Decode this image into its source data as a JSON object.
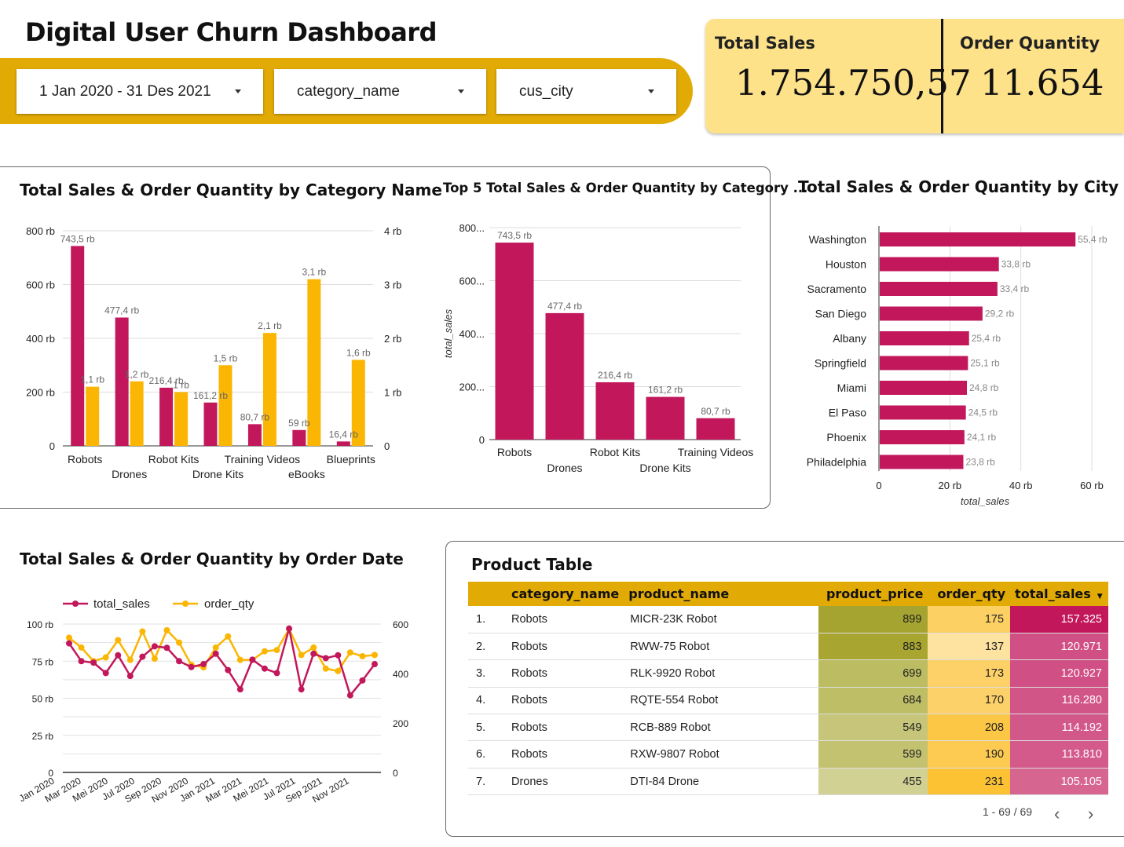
{
  "page": {
    "title": "Digital User Churn Dashboard"
  },
  "filters": [
    {
      "label": "1 Jan 2020 - 31 Des 2021",
      "icon": "chevron-down-icon"
    },
    {
      "label": "category_name",
      "icon": "chevron-down-icon"
    },
    {
      "label": "cus_city",
      "icon": "chevron-down-icon"
    }
  ],
  "kpis": [
    {
      "label": "Total Sales",
      "value": "1.754.750,57"
    },
    {
      "label": "Order Quantity",
      "value": "11.654"
    }
  ],
  "colors": {
    "sales": "#c2185b",
    "qty": "#fbb603",
    "accent": "#e2aa05",
    "kpi_bg": "#fde28a"
  },
  "chart_data": [
    {
      "type": "bar",
      "title": "Total Sales & Order Quantity by Category Name",
      "categories": [
        "Robots",
        "Drones",
        "Robot Kits",
        "Drone Kits",
        "Training Videos",
        "eBooks",
        "Blueprints"
      ],
      "series": [
        {
          "name": "total_sales",
          "axis": "left",
          "values": [
            743.5,
            477.4,
            216.4,
            161.2,
            80.7,
            59,
            16.4
          ],
          "labels": [
            "743,5 rb",
            "477,4 rb",
            "216,4 rb",
            "161,2 rb",
            "80,7 rb",
            "59 rb",
            "16,4 rb"
          ]
        },
        {
          "name": "order_qty",
          "axis": "right",
          "values": [
            1.1,
            1.2,
            1,
            1.5,
            2.1,
            3.1,
            1.6
          ],
          "labels": [
            "1,1 rb",
            "1,2 rb",
            "1 rb",
            "1,5 rb",
            "2,1 rb",
            "3,1 rb",
            "1,6 rb"
          ]
        }
      ],
      "y_left_ticks": [
        "0",
        "200 rb",
        "400 rb",
        "600 rb",
        "800 rb"
      ],
      "y_right_ticks": [
        "0",
        "1 rb",
        "2 rb",
        "3 rb",
        "4 rb"
      ],
      "ylim_left": [
        0,
        800
      ],
      "ylim_right": [
        0,
        4
      ],
      "grid": true
    },
    {
      "type": "bar",
      "title": "Top 5 Total Sales & Order Quantity by Category ...",
      "categories": [
        "Robots",
        "Drones",
        "Robot Kits",
        "Drone Kits",
        "Training Videos"
      ],
      "series": [
        {
          "name": "total_sales",
          "values": [
            743.5,
            477.4,
            216.4,
            161.2,
            80.7
          ],
          "labels": [
            "743,5 rb",
            "477,4 rb",
            "216,4 rb",
            "161,2 rb",
            "80,7 rb"
          ]
        }
      ],
      "ylabel": "total_sales",
      "y_ticks": [
        "0",
        "200...",
        "400...",
        "600...",
        "800..."
      ],
      "ylim": [
        0,
        800
      ],
      "grid": true
    },
    {
      "type": "bar",
      "orientation": "horizontal",
      "title": "Total Sales & Order Quantity by City",
      "categories": [
        "Washington",
        "Houston",
        "Sacramento",
        "San Diego",
        "Albany",
        "Springfield",
        "Miami",
        "El Paso",
        "Phoenix",
        "Philadelphia"
      ],
      "series": [
        {
          "name": "total_sales",
          "values": [
            55.4,
            33.8,
            33.4,
            29.2,
            25.4,
            25.1,
            24.8,
            24.5,
            24.1,
            23.8
          ],
          "labels": [
            "55,4 rb",
            "33,8 rb",
            "33,4 rb",
            "29,2 rb",
            "25,4 rb",
            "25,1 rb",
            "24,8 rb",
            "24,5 rb",
            "24,1 rb",
            "23,8 rb"
          ]
        }
      ],
      "xlabel": "total_sales",
      "x_ticks": [
        "0",
        "20 rb",
        "40 rb",
        "60 rb"
      ],
      "xlim": [
        0,
        60
      ],
      "grid": true
    },
    {
      "type": "line",
      "title": "Total Sales & Order Quantity by Order Date",
      "legend": [
        "total_sales",
        "order_qty"
      ],
      "legend_position": "top-left",
      "x_ticks": [
        "Jan 2020",
        "Mar 2020",
        "Mei 2020",
        "Jul 2020",
        "Sep 2020",
        "Nov 2020",
        "Jan 2021",
        "Mar 2021",
        "Mei 2021",
        "Jul 2021",
        "Sep 2021",
        "Nov 2021"
      ],
      "y_left_ticks": [
        "0",
        "25 rb",
        "50 rb",
        "75 rb",
        "100 rb"
      ],
      "y_right_ticks": [
        "0",
        "200",
        "400",
        "600"
      ],
      "ylim_left": [
        0,
        100
      ],
      "ylim_right": [
        0,
        600
      ],
      "series": [
        {
          "name": "total_sales",
          "axis": "left",
          "values": [
            87,
            75,
            74,
            67,
            79,
            65,
            78,
            85,
            84,
            75,
            71,
            73,
            80,
            69,
            56,
            76,
            70,
            67,
            97,
            56,
            80,
            77,
            79,
            52,
            62,
            73
          ]
        },
        {
          "name": "order_qty",
          "axis": "right",
          "values": [
            545,
            505,
            450,
            465,
            535,
            455,
            570,
            460,
            575,
            525,
            435,
            425,
            505,
            550,
            455,
            455,
            490,
            495,
            580,
            475,
            505,
            420,
            410,
            485,
            470,
            475
          ]
        }
      ],
      "grid": true
    }
  ],
  "product_table": {
    "title": "Product Table",
    "columns": [
      "category_name",
      "product_name",
      "product_price",
      "order_qty",
      "total_sales"
    ],
    "sort_icon": "sort-down-icon",
    "rows": [
      [
        "1.",
        "Robots",
        "MICR-23K Robot",
        "899",
        "175",
        "157.325"
      ],
      [
        "2.",
        "Robots",
        "RWW-75 Robot",
        "883",
        "137",
        "120.971"
      ],
      [
        "3.",
        "Robots",
        "RLK-9920 Robot",
        "699",
        "173",
        "120.927"
      ],
      [
        "4.",
        "Robots",
        "RQTE-554 Robot",
        "684",
        "170",
        "116.280"
      ],
      [
        "5.",
        "Robots",
        "RCB-889 Robot",
        "549",
        "208",
        "114.192"
      ],
      [
        "6.",
        "Robots",
        "RXW-9807 Robot",
        "599",
        "190",
        "113.810"
      ],
      [
        "7.",
        "Drones",
        "DTI-84 Drone",
        "455",
        "231",
        "105.105"
      ]
    ],
    "price_colors": [
      "#a6a431",
      "#a8a631",
      "#bcbc62",
      "#bebe66",
      "#c6c57a",
      "#c3c271",
      "#d2d194"
    ],
    "qty_colors": [
      "#fdd064",
      "#fee2a0",
      "#fdd167",
      "#fdd16a",
      "#fdc746",
      "#fdcb52",
      "#fdc234"
    ],
    "sales_colors": [
      "#c2185b",
      "#d04f84",
      "#d04f84",
      "#d25588",
      "#d25889",
      "#d35a8a",
      "#d6658f"
    ],
    "pagination": "1 - 69 / 69",
    "prev_icon": "chevron-left-icon",
    "next_icon": "chevron-right-icon"
  }
}
